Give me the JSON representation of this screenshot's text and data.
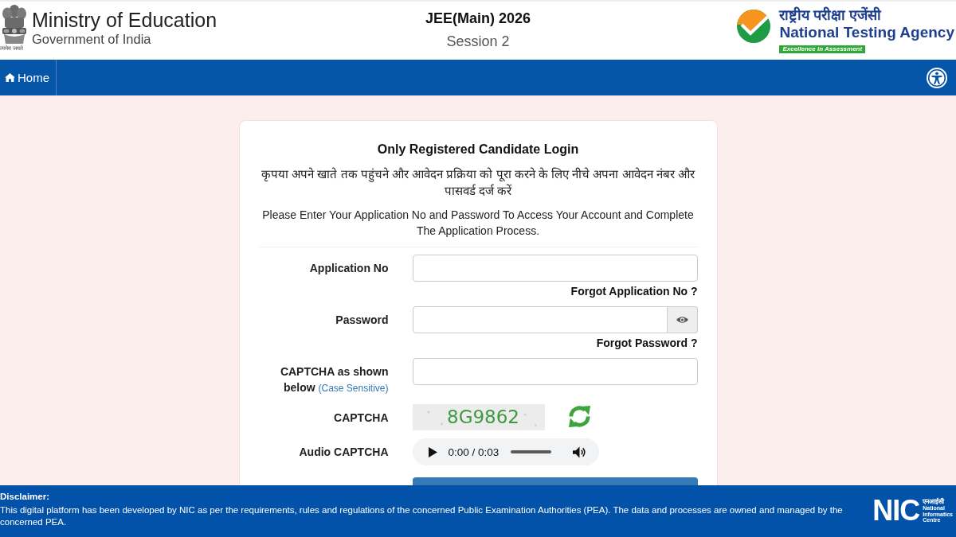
{
  "header": {
    "emblem_motto": "त्यमेव जयते",
    "ministry": "Ministry of Education",
    "government": "Government of India",
    "exam_title": "JEE(Main) 2026",
    "session": "Session 2",
    "agency_hindi": "राष्ट्रीय परीक्षा एजेंसी",
    "agency_name": "National Testing Agency",
    "agency_tagline": "Excellence in Assessment"
  },
  "nav": {
    "items": [
      {
        "label": "Home"
      }
    ]
  },
  "login": {
    "title": "Only Registered Candidate Login",
    "intro_hindi": "कृपया अपने खाते तक पहुंचने और आवेदन प्रक्रिया को पूरा करने के लिए नीचे अपना आवेदन नंबर और पासवर्ड दर्ज करें",
    "intro_english": "Please Enter Your Application No and Password To Access Your Account and Complete The Application Process.",
    "fields": [
      {
        "kind": "text",
        "label": "Application No",
        "link": "Forgot Application No ?"
      },
      {
        "kind": "password",
        "label": "Password",
        "link": "Forgot Password ?"
      },
      {
        "kind": "text",
        "label": "CAPTCHA as shown below",
        "note": "(Case Sensitive)"
      },
      {
        "kind": "captcha",
        "label": "CAPTCHA",
        "code": "8G9862"
      },
      {
        "kind": "audio",
        "label": "Audio CAPTCHA",
        "time": "0:00 / 0:03",
        "level": 0
      },
      {
        "kind": "button"
      }
    ]
  },
  "footer": {
    "heading": "Disclaimer:",
    "text": "This digital platform has been developed by NIC as per the requirements, rules and regulations of the concerned Public Examination Authorities (PEA). The data and processes are owned and managed by the concerned PEA.",
    "logo": {
      "mark": "NIC",
      "hindi": "एनआईसी",
      "lines": [
        "National",
        "Informatics",
        "Centre"
      ]
    }
  }
}
